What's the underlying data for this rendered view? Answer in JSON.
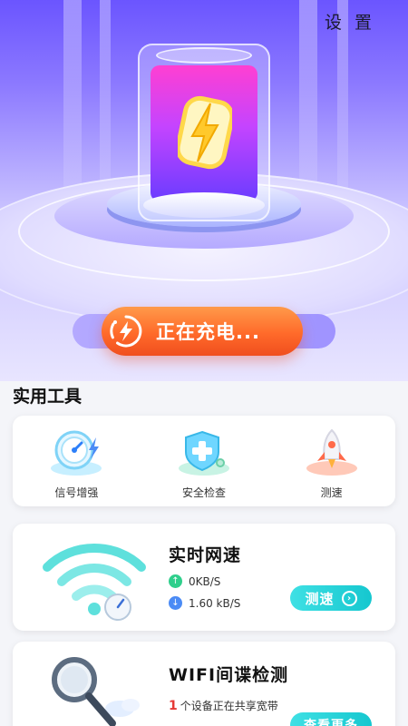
{
  "header": {
    "settings_label": "设 置"
  },
  "status": {
    "charging_text": "正在充电..."
  },
  "tools": {
    "section_title": "实用工具",
    "items": [
      {
        "label": "信号增强",
        "icon": "speedometer-icon"
      },
      {
        "label": "安全检查",
        "icon": "shield-icon"
      },
      {
        "label": "测速",
        "icon": "rocket-icon"
      }
    ]
  },
  "speed": {
    "title": "实时网速",
    "upload": "0KB/S",
    "download": "1.60 kB/S",
    "button_label": "测速",
    "colors": {
      "upload": "#2fcf8c",
      "download": "#4b8bf5",
      "button": "#15c7cf"
    }
  },
  "spy": {
    "title": "WIFI间谍检测",
    "device_count": "1",
    "description": "个设备正在共享宽带",
    "button_label": "查看更多"
  },
  "colors": {
    "accent": "#ff6a2a",
    "hero": "#6b55ff"
  }
}
